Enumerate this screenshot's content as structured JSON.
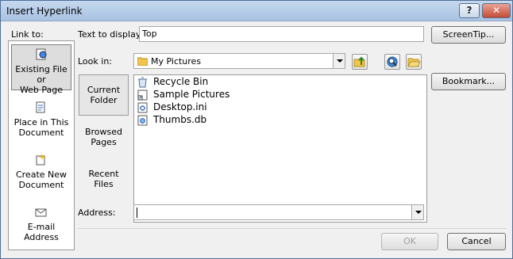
{
  "window": {
    "title": "Insert Hyperlink",
    "help_label": "?",
    "close_label": "✕"
  },
  "link_to": {
    "label": "Link to:",
    "items": [
      {
        "label_a": "Existing File or",
        "label_b": "Web Page",
        "selected": true,
        "icon": "web-page-icon"
      },
      {
        "label_a": "Place in This",
        "label_b": "Document",
        "selected": false,
        "icon": "document-place-icon"
      },
      {
        "label_a": "Create New",
        "label_b": "Document",
        "selected": false,
        "icon": "new-document-icon"
      },
      {
        "label_a": "E-mail Address",
        "label_b": "",
        "selected": false,
        "icon": "email-icon"
      }
    ]
  },
  "text_to_display": {
    "label": "Text to display:",
    "value": "Top"
  },
  "screentip_label": "ScreenTip...",
  "look_in": {
    "label": "Look in:",
    "value": "My Pictures"
  },
  "bookmark_label": "Bookmark...",
  "nav": {
    "items": [
      {
        "label_a": "Current",
        "label_b": "Folder",
        "selected": true
      },
      {
        "label_a": "Browsed",
        "label_b": "Pages",
        "selected": false
      },
      {
        "label_a": "Recent",
        "label_b": "Files",
        "selected": false
      }
    ]
  },
  "files": [
    {
      "name": "Recycle Bin",
      "icon": "recycle-bin-icon"
    },
    {
      "name": "Sample Pictures",
      "icon": "shortcut-icon"
    },
    {
      "name": "Desktop.ini",
      "icon": "settings-file-icon"
    },
    {
      "name": "Thumbs.db",
      "icon": "database-file-icon"
    }
  ],
  "address": {
    "label": "Address:",
    "value": ""
  },
  "ok_label": "OK",
  "cancel_label": "Cancel",
  "colors": {
    "title_bar": "#b4cbe8",
    "close_button": "#c44b36",
    "panel_bg": "#f0f0f0"
  }
}
